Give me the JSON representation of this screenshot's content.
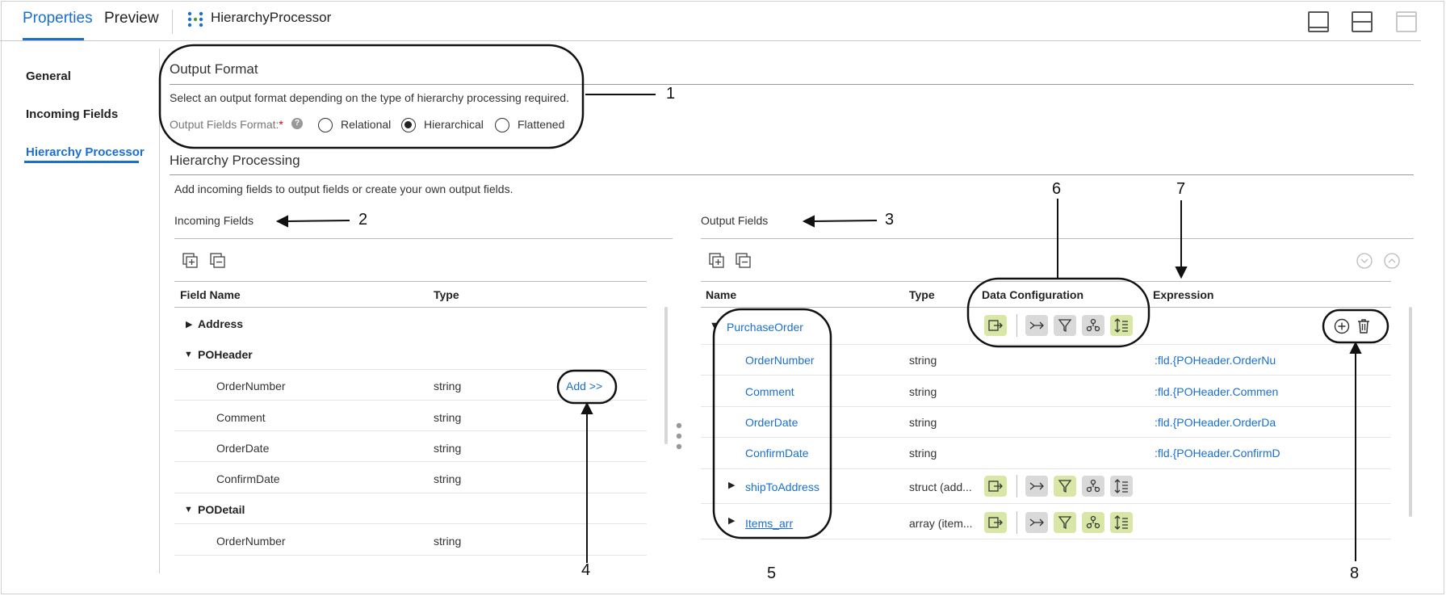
{
  "tabs": [
    {
      "label": "Properties"
    },
    {
      "label": "Preview"
    }
  ],
  "window_title": "HierarchyProcessor",
  "nav": {
    "items": [
      {
        "label": "General"
      },
      {
        "label": "Incoming Fields"
      },
      {
        "label": "Hierarchy Processor"
      }
    ]
  },
  "output_format": {
    "title": "Output Format",
    "description": "Select an output format depending on the type of hierarchy processing required.",
    "fields_label": "Output Fields Format:",
    "required_mark": "*",
    "help_label": "?",
    "options": [
      {
        "label": "Relational",
        "selected": false
      },
      {
        "label": "Hierarchical",
        "selected": true
      },
      {
        "label": "Flattened",
        "selected": false
      }
    ]
  },
  "hierarchy": {
    "title": "Hierarchy Processing",
    "description": "Add incoming fields to output fields or create your own output fields."
  },
  "incoming": {
    "title": "Incoming Fields",
    "columns": [
      "Field Name",
      "Type"
    ],
    "add_label": "Add >>",
    "rows": [
      {
        "name": "Address",
        "type": ""
      },
      {
        "name": "POHeader",
        "type": ""
      },
      {
        "name": "OrderNumber",
        "type": "string"
      },
      {
        "name": "Comment",
        "type": "string"
      },
      {
        "name": "OrderDate",
        "type": "string"
      },
      {
        "name": "ConfirmDate",
        "type": "string"
      },
      {
        "name": "PODetail",
        "type": ""
      },
      {
        "name": "OrderNumber",
        "type": "string"
      }
    ]
  },
  "output": {
    "title": "Output Fields",
    "columns": [
      "Name",
      "Type",
      "Data Configuration",
      "Expression"
    ],
    "rows": [
      {
        "name": "PurchaseOrder",
        "type": "",
        "expression": ""
      },
      {
        "name": "OrderNumber",
        "type": "string",
        "expression": ":fld.{POHeader.OrderNu"
      },
      {
        "name": "Comment",
        "type": "string",
        "expression": ":fld.{POHeader.Commen"
      },
      {
        "name": "OrderDate",
        "type": "string",
        "expression": ":fld.{POHeader.OrderDa"
      },
      {
        "name": "ConfirmDate",
        "type": "string",
        "expression": ":fld.{POHeader.ConfirmD"
      },
      {
        "name": "shipToAddress",
        "type": "struct (add...",
        "expression": ""
      },
      {
        "name": "Items_arr",
        "type": "array (item...",
        "expression": ""
      }
    ]
  },
  "annotations": [
    "1",
    "2",
    "3",
    "4",
    "5",
    "6",
    "7",
    "8"
  ],
  "colors": {
    "accent": "#1a6fcf",
    "button_green": "#d9e7a6",
    "button_gray": "#d9d9d9"
  },
  "icons": [
    "layout-bottom-icon",
    "layout-split-icon",
    "layout-full-icon",
    "expand-all-icon",
    "collapse-all-icon",
    "output-icon",
    "router-icon",
    "filter-icon",
    "sort-group-icon",
    "order-icon",
    "add-icon",
    "delete-icon",
    "chevron-down-icon",
    "chevron-up-icon"
  ]
}
